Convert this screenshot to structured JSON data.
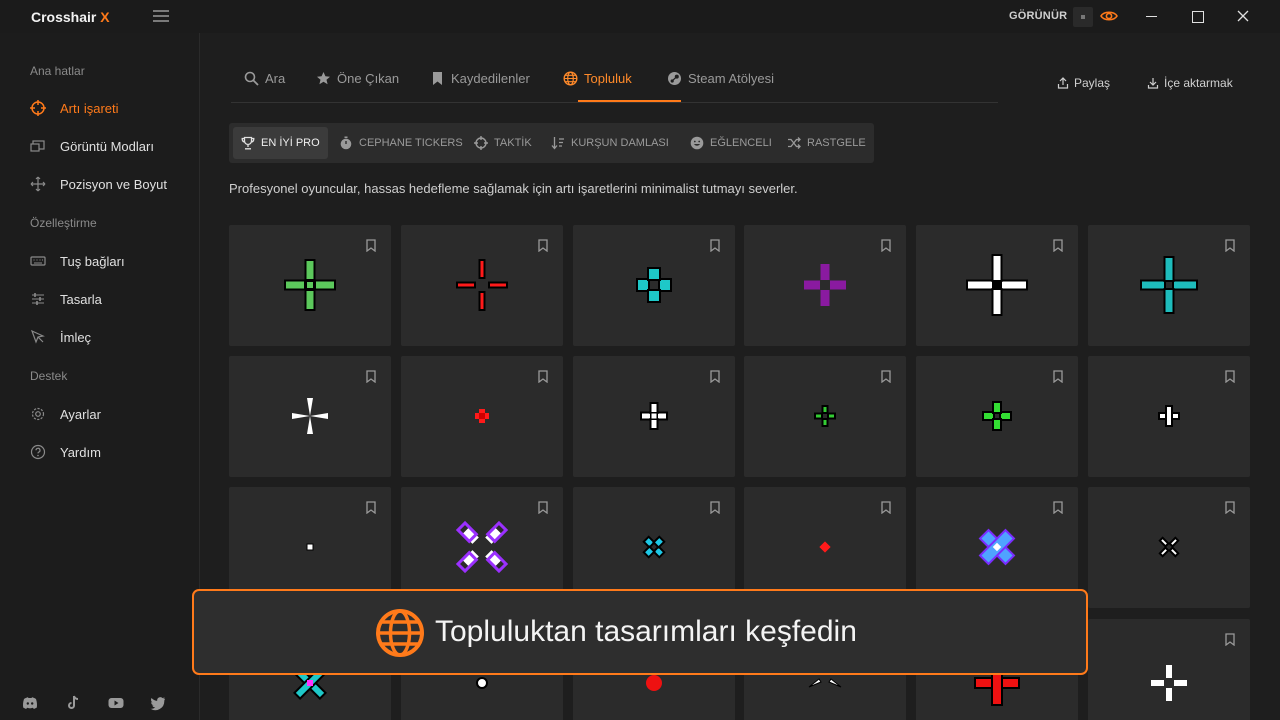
{
  "window": {
    "app_name": "Crosshair",
    "app_name_accent": "X",
    "visibility_label": "GÖRÜNÜR"
  },
  "sidebar": {
    "sections": [
      {
        "label": "Ana hatlar",
        "items": [
          {
            "label": "Artı işareti",
            "icon": "crosshair-icon",
            "active": true
          },
          {
            "label": "Görüntü Modları",
            "icon": "display-modes-icon"
          },
          {
            "label": "Pozisyon ve Boyut",
            "icon": "move-icon"
          }
        ]
      },
      {
        "label": "Özelleştirme",
        "items": [
          {
            "label": "Tuş bağları",
            "icon": "keyboard-icon"
          },
          {
            "label": "Tasarla",
            "icon": "sliders-icon"
          },
          {
            "label": "İmleç",
            "icon": "cursor-icon"
          }
        ]
      },
      {
        "label": "Destek",
        "items": [
          {
            "label": "Ayarlar",
            "icon": "gear-icon"
          },
          {
            "label": "Yardım",
            "icon": "help-icon"
          }
        ]
      }
    ],
    "social": [
      "discord-icon",
      "tiktok-icon",
      "youtube-icon",
      "twitter-icon"
    ]
  },
  "tabs": [
    {
      "label": "Ara",
      "icon": "search-icon"
    },
    {
      "label": "Öne Çıkan",
      "icon": "star-icon"
    },
    {
      "label": "Kaydedilenler",
      "icon": "bookmark-icon"
    },
    {
      "label": "Topluluk",
      "icon": "globe-icon",
      "active": true
    },
    {
      "label": "Steam Atölyesi",
      "icon": "steam-icon"
    }
  ],
  "actions": {
    "share": "Paylaş",
    "import": "İçe aktarmak"
  },
  "filters": [
    {
      "label": "EN İYİ PRO",
      "icon": "trophy-icon",
      "active": true
    },
    {
      "label": "CEPHANE TICKERS",
      "icon": "stopwatch-icon"
    },
    {
      "label": "TAKTİK",
      "icon": "target-icon"
    },
    {
      "label": "KURŞUN DAMLASI",
      "icon": "sort-down-icon"
    },
    {
      "label": "EĞLENCELI",
      "icon": "smile-icon"
    },
    {
      "label": "RASTGELE",
      "icon": "shuffle-icon"
    }
  ],
  "description": "Profesyonel oyuncular, hassas hedefleme sağlamak için artı işaretlerini minimalist tutmayı severler.",
  "colors": {
    "accent": "#ff7a1a",
    "crosshairs": [
      "#5cc85c",
      "#ff1a1a",
      "#1ec8c8",
      "#8a1aa0",
      "#ffffff",
      "#1ebcbc",
      "#ffffff",
      "#ff1a1a",
      "#ffffff",
      "#33cc33",
      "#33dd33",
      "#ffffff",
      "#ffffff",
      "#9b30ff",
      "#1ec8e6",
      "#ff1a1a",
      "#4fa3ff",
      "#ffffff"
    ]
  },
  "toast": {
    "text": "Topluluktan tasarımları keşfedin",
    "icon": "globe-icon"
  }
}
